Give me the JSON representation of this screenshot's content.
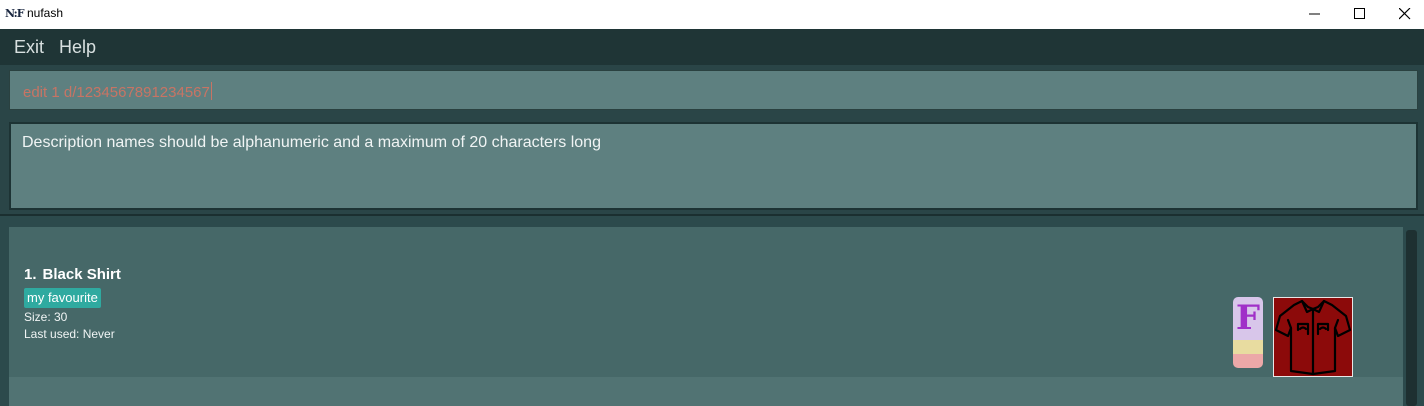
{
  "window": {
    "logo": "N:F",
    "title": "nufash"
  },
  "menu": {
    "items": [
      "Exit",
      "Help"
    ]
  },
  "command": {
    "value": "edit 1 d/1234567891234567"
  },
  "result": {
    "message": "Description names should be alphanumeric and a maximum of 20 characters long"
  },
  "list": {
    "items": [
      {
        "index": "1.",
        "name": "Black Shirt",
        "tag": "my favourite",
        "size": "Size: 30",
        "last_used": "Last used: Never",
        "type_letter": "F",
        "image_icon": "shirt-icon"
      }
    ]
  },
  "colors": {
    "accent_tag": "#2faaa0",
    "command_text": "#c87464",
    "shirt_bg": "#8c0a0a",
    "type_letter": "#a030c8"
  }
}
